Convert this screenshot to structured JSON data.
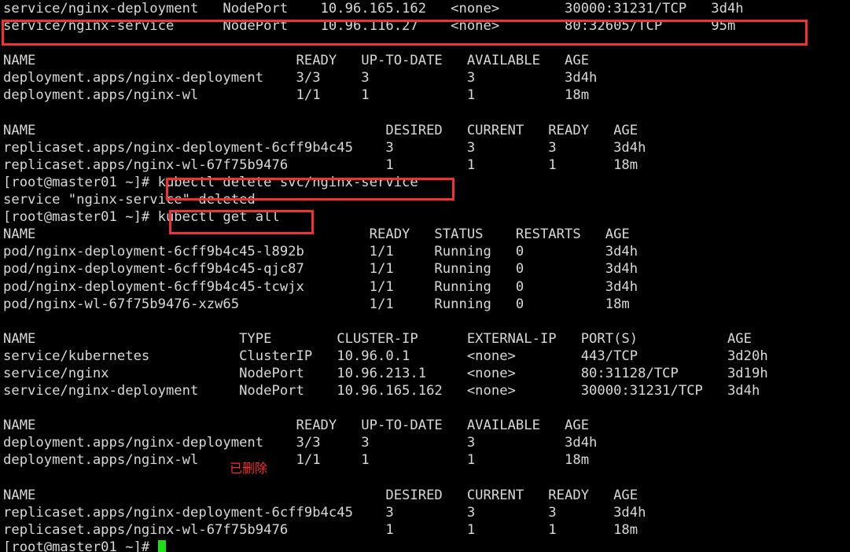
{
  "terminal": {
    "prompt": "[root@master01 ~]# ",
    "cursor_color": "#19e019",
    "foreground": "#d8d8d8",
    "background": "#000000",
    "annotation_color": "#f43030",
    "lines": [
      "service/nginx-deployment   NodePort    10.96.165.162   <none>        30000:31231/TCP   3d4h",
      "service/nginx-service      NodePort    10.96.116.27    <none>        80:32605/TCP      95m",
      "",
      "NAME                                READY   UP-TO-DATE   AVAILABLE   AGE",
      "deployment.apps/nginx-deployment    3/3     3            3           3d4h",
      "deployment.apps/nginx-wl            1/1     1            1           18m",
      "",
      "NAME                                           DESIRED   CURRENT   READY   AGE",
      "replicaset.apps/nginx-deployment-6cff9b4c45    3         3         3       3d4h",
      "replicaset.apps/nginx-wl-67f75b9476            1         1         1       18m",
      "[root@master01 ~]# kubectl delete svc/nginx-service",
      "service \"nginx-service\" deleted",
      "[root@master01 ~]# kubectl get all",
      "NAME                                         READY   STATUS    RESTARTS   AGE",
      "pod/nginx-deployment-6cff9b4c45-l892b        1/1     Running   0          3d4h",
      "pod/nginx-deployment-6cff9b4c45-qjc87        1/1     Running   0          3d4h",
      "pod/nginx-deployment-6cff9b4c45-tcwjx        1/1     Running   0          3d4h",
      "pod/nginx-wl-67f75b9476-xzw65                1/1     Running   0          18m",
      "",
      "NAME                         TYPE        CLUSTER-IP      EXTERNAL-IP   PORT(S)           AGE",
      "service/kubernetes           ClusterIP   10.96.0.1       <none>        443/TCP           3d20h",
      "service/nginx                NodePort    10.96.213.1     <none>        80:31128/TCP      3d19h",
      "service/nginx-deployment     NodePort    10.96.165.162   <none>        30000:31231/TCP   3d4h",
      "",
      "NAME                                READY   UP-TO-DATE   AVAILABLE   AGE",
      "deployment.apps/nginx-deployment    3/3     3            3           3d4h",
      "deployment.apps/nginx-wl            1/1     1            1           18m",
      "",
      "NAME                                           DESIRED   CURRENT   READY   AGE",
      "replicaset.apps/nginx-deployment-6cff9b4c45    3         3         3       3d4h",
      "replicaset.apps/nginx-wl-67f75b9476            1         1         1       18m"
    ],
    "last_prompt": "[root@master01 ~]# "
  },
  "annotations": {
    "deleted_label": "已删除",
    "highlight_service_row": "service/nginx-service      NodePort    10.96.116.27    <none>        80:32605/TCP      95m",
    "highlight_delete_command": "kubectl delete svc/nginx-service",
    "highlight_get_all_command": "kubectl get all"
  }
}
